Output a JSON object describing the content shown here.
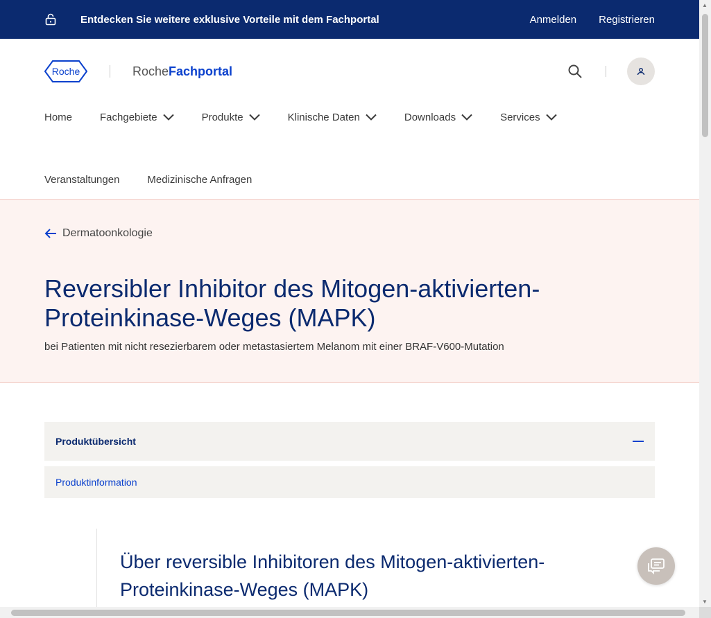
{
  "topbar": {
    "promo": "Entdecken Sie weitere exklusive Vorteile mit dem Fachportal",
    "login": "Anmelden",
    "register": "Registrieren",
    "icon": "lock-icon"
  },
  "header": {
    "logo_text": "Roche",
    "brand_prefix": "Roche",
    "brand_bold": "Fachportal"
  },
  "nav": {
    "row1": [
      "Home",
      "Fachgebiete",
      "Produkte",
      "Klinische Daten",
      "Downloads",
      "Services"
    ],
    "row2": [
      "Veranstaltungen",
      "Medizinische Anfragen"
    ]
  },
  "hero": {
    "back_label": "Dermatoonkologie",
    "title": "Reversibler Inhibitor des Mitogen-aktivierten-Proteinkinase-Weges (MAPK)",
    "subtitle": "bei Patienten mit nicht resezierbarem oder metastasiertem Melanom mit einer BRAF-V600-Mutation"
  },
  "accordion": {
    "header": "Produktübersicht",
    "link": "Produktinformation"
  },
  "content": {
    "heading": "Über reversible Inhibitoren des Mitogen-aktivierten-Proteinkinase-Weges (MAPK)"
  },
  "colors": {
    "topbar_bg": "#0b2a6f",
    "brand_blue": "#0b41cd",
    "hero_bg": "#fdf3f1",
    "panel_bg": "#f3f2ef"
  }
}
